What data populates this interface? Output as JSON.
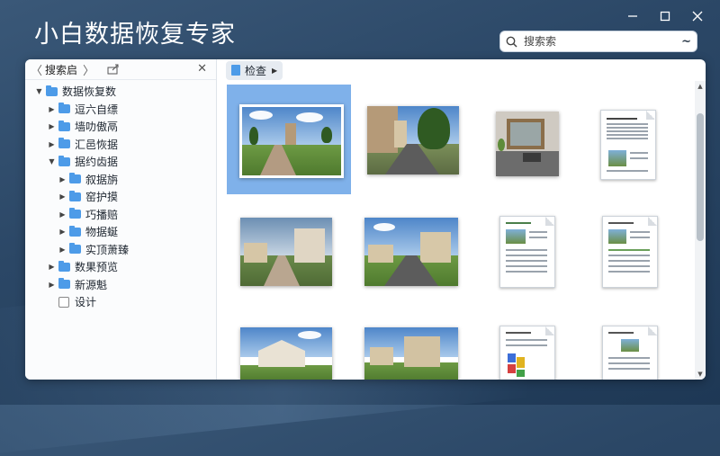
{
  "app": {
    "title": "小白数据恢复专家"
  },
  "search": {
    "placeholder": "搜索索",
    "filter_glyph": "~"
  },
  "window_controls": [
    "minimize",
    "maximize",
    "close"
  ],
  "left_panel": {
    "location_label": "搜索启",
    "back_glyph": "〈",
    "forward_glyph": "〉",
    "close_glyph": "✕"
  },
  "tree": [
    {
      "label": "数据恢复数",
      "expanded": true
    },
    {
      "label": "逗六自缥",
      "expanded": false
    },
    {
      "label": "墙叻傲鬲",
      "expanded": false
    },
    {
      "label": "汇邑恢据",
      "expanded": false
    },
    {
      "label": "据约齿据",
      "expanded": true
    },
    {
      "label": "叙据旃",
      "expanded": false
    },
    {
      "label": "窑护摸",
      "expanded": false
    },
    {
      "label": "巧播赔",
      "expanded": false
    },
    {
      "label": "物据蜒",
      "expanded": false
    },
    {
      "label": "实顶萧臻",
      "expanded": false
    },
    {
      "label": "数果预览",
      "expanded": false
    },
    {
      "label": "新源魁",
      "expanded": false
    },
    {
      "label": "设计",
      "expanded": false
    }
  ],
  "breadcrumb": {
    "label": "检查"
  },
  "grid": {
    "items": [
      {
        "kind": "photo",
        "scene": "chapel-field",
        "selected": true
      },
      {
        "kind": "photo",
        "scene": "street-trees",
        "selected": false
      },
      {
        "kind": "photo",
        "scene": "desk-room",
        "selected": false
      },
      {
        "kind": "document",
        "scene": "doc-text",
        "selected": false
      },
      {
        "kind": "photo",
        "scene": "village-road",
        "selected": false
      },
      {
        "kind": "photo",
        "scene": "village-road-2",
        "selected": false
      },
      {
        "kind": "document",
        "scene": "doc-report",
        "selected": false
      },
      {
        "kind": "document",
        "scene": "doc-report-2",
        "selected": false
      },
      {
        "kind": "photo",
        "scene": "house",
        "selected": false
      },
      {
        "kind": "photo",
        "scene": "mansion",
        "selected": false
      },
      {
        "kind": "document",
        "scene": "doc-chart",
        "selected": false
      },
      {
        "kind": "document",
        "scene": "doc-chart-2",
        "selected": false
      }
    ]
  },
  "colors": {
    "accent": "#4d9be8",
    "selection": "#7fb1ea",
    "background": "#2b4766"
  }
}
